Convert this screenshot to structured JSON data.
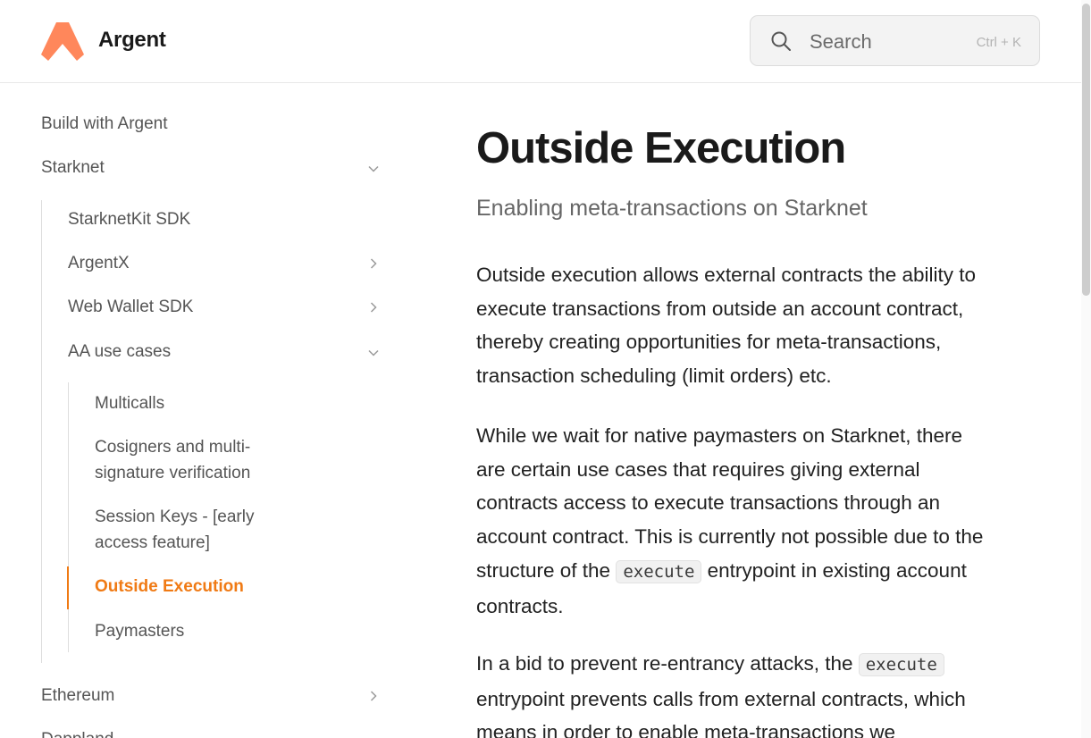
{
  "header": {
    "brand": "Argent",
    "search": {
      "placeholder": "Search",
      "shortcut": "Ctrl + K"
    }
  },
  "sidebar": {
    "build_with_argent": "Build with Argent",
    "starknet": "Starknet",
    "starknet_children": {
      "starknetkit_sdk": "StarknetKit SDK",
      "argentx": "ArgentX",
      "web_wallet_sdk": "Web Wallet SDK",
      "aa_use_cases": "AA use cases"
    },
    "aa_children": {
      "multicalls": "Multicalls",
      "cosigners_line1": "Cosigners and multi-",
      "cosigners_line2": "signature verification",
      "session_keys_line1": "Session Keys - [early",
      "session_keys_line2": "access feature]",
      "outside_execution": "Outside Execution",
      "paymasters": "Paymasters"
    },
    "ethereum": "Ethereum",
    "dappland": "Dappland"
  },
  "main": {
    "title": "Outside Execution",
    "subtitle": "Enabling meta-transactions on Starknet",
    "p1": "Outside execution allows external contracts the ability to execute transactions from outside an account contract, thereby creating opportunities for meta-transactions, transaction scheduling (limit orders) etc.",
    "p2_before": "While we wait for native paymasters on Starknet, there are certain use cases that requires giving external contracts access to execute transactions through an account contract. This is currently not possible due to the structure of the ",
    "p2_code": "execute",
    "p2_after": " entrypoint in existing account contracts.",
    "p3_before": "In a bid to prevent re-entrancy attacks, the ",
    "p3_code": "execute",
    "p3_after": " entrypoint prevents calls from external contracts, which means in order to enable meta-transactions we"
  },
  "colors": {
    "accent": "#f07a14",
    "logo": "#ff875b"
  }
}
